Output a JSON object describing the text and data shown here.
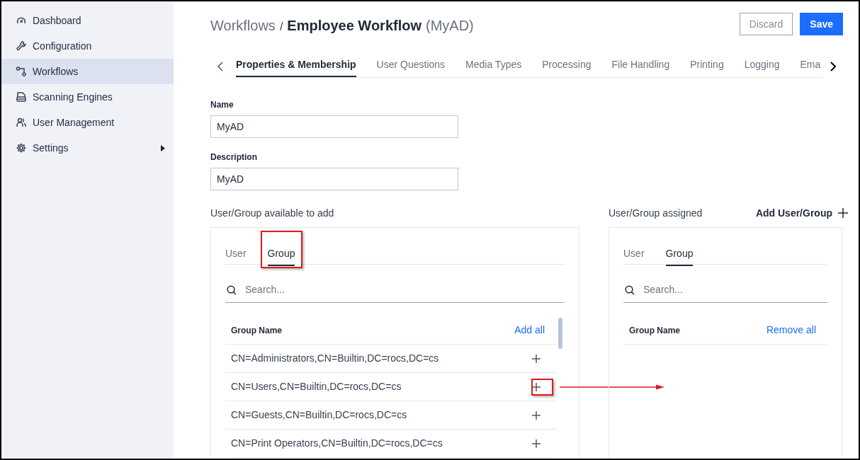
{
  "sidebar": {
    "items": [
      {
        "label": "Dashboard",
        "selected": false,
        "has_submenu": false
      },
      {
        "label": "Configuration",
        "selected": false,
        "has_submenu": false
      },
      {
        "label": "Workflows",
        "selected": true,
        "has_submenu": false
      },
      {
        "label": "Scanning Engines",
        "selected": false,
        "has_submenu": false
      },
      {
        "label": "User Management",
        "selected": false,
        "has_submenu": false
      },
      {
        "label": "Settings",
        "selected": false,
        "has_submenu": true
      }
    ]
  },
  "header": {
    "breadcrumb": "Workflows",
    "separator": "/",
    "title": "Employee Workflow",
    "subtitle": "(MyAD)",
    "buttons": [
      {
        "label": "Discard",
        "kind": "secondary"
      },
      {
        "label": "Save",
        "kind": "primary"
      }
    ]
  },
  "tabs": [
    {
      "label": "Properties & Membership",
      "selected": true
    },
    {
      "label": "User Questions",
      "selected": false
    },
    {
      "label": "Media Types",
      "selected": false
    },
    {
      "label": "Processing",
      "selected": false
    },
    {
      "label": "File Handling",
      "selected": false
    },
    {
      "label": "Printing",
      "selected": false
    },
    {
      "label": "Logging",
      "selected": false
    },
    {
      "label": "Ema",
      "selected": false
    }
  ],
  "fields": [
    {
      "label": "Name",
      "value": "MyAD"
    },
    {
      "label": "Description",
      "value": "MyAD"
    }
  ],
  "available": {
    "title": "User/Group available to add",
    "tabs": [
      {
        "label": "User",
        "selected": false,
        "highlighted": false
      },
      {
        "label": "Group",
        "selected": true,
        "highlighted": true
      }
    ],
    "search": {
      "placeholder": "Search..."
    },
    "column": "Group Name",
    "action": "Add all",
    "rows": [
      {
        "name": "CN=Administrators,CN=Builtin,DC=rocs,DC=cs",
        "highlighted": false
      },
      {
        "name": "CN=Users,CN=Builtin,DC=rocs,DC=cs",
        "highlighted": true
      },
      {
        "name": "CN=Guests,CN=Builtin,DC=rocs,DC=cs",
        "highlighted": false
      },
      {
        "name": "CN=Print Operators,CN=Builtin,DC=rocs,DC=cs",
        "highlighted": false
      }
    ]
  },
  "assigned": {
    "title": "User/Group assigned",
    "add_label": "Add User/Group",
    "tabs": [
      {
        "label": "User",
        "selected": false
      },
      {
        "label": "Group",
        "selected": true
      }
    ],
    "search": {
      "placeholder": "Search..."
    },
    "column": "Group Name",
    "action": "Remove all"
  }
}
